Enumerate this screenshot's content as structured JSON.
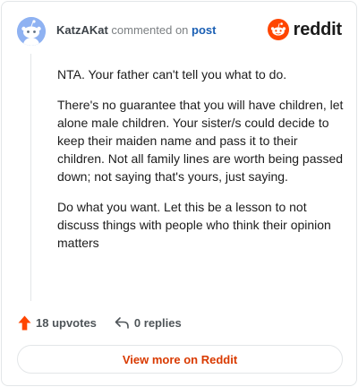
{
  "comment": {
    "author": "KatzAKat",
    "action_text": "commented on",
    "post_link_text": "post"
  },
  "brand": {
    "logo_text": "reddit",
    "color": "#ff4500"
  },
  "body": {
    "paragraphs": [
      "NTA. Your father can't tell you what to do.",
      "There's no guarantee that you will have children, let alone male children. Your sister/s could decide to keep their maiden name and pass it to their children. Not all family lines are worth being passed down; not saying that's yours, just saying.",
      "Do what you want. Let this be a lesson to not discuss things with people who think their opinion matters"
    ]
  },
  "actions": {
    "upvotes": "18 upvotes",
    "replies": "0 replies",
    "upvote_color": "#ff4500"
  },
  "cta": {
    "label": "View more on Reddit",
    "color": "#d93a00"
  }
}
